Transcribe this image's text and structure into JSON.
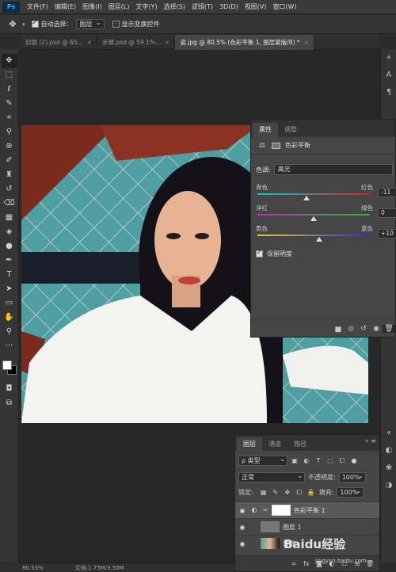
{
  "menubar": {
    "logo": "Ps",
    "items": [
      "文件(F)",
      "编辑(E)",
      "图像(I)",
      "图层(L)",
      "文字(Y)",
      "选择(S)",
      "滤镜(T)",
      "3D(D)",
      "视图(V)",
      "窗口(W)"
    ]
  },
  "options": {
    "auto_select_label": "自动选择：",
    "auto_select_value": "图层",
    "show_transform_label": "显示变换控件"
  },
  "doc_tabs": [
    {
      "label": "封面 (2).psd @ 65...",
      "active": false
    },
    {
      "label": "步骤.psd @ 59.1%...",
      "active": false
    },
    {
      "label": "姿.jpg @ 80.5% (色彩平衡 1, 图层蒙版/8) *",
      "active": true
    }
  ],
  "properties": {
    "tab_properties": "属性",
    "tab_adjustments": "调整",
    "adjustment_title": "色彩平衡",
    "tone_label": "色调:",
    "tone_value": "高光",
    "sliders": [
      {
        "left": "青色",
        "right": "红色",
        "value": -11,
        "colors": [
          "#00c8d0",
          "#e02020"
        ]
      },
      {
        "left": "洋红",
        "right": "绿色",
        "value": 0,
        "colors": [
          "#d020c0",
          "#20c030"
        ]
      },
      {
        "left": "黄色",
        "right": "蓝色",
        "value": 10,
        "colors": [
          "#e0d020",
          "#2030e0"
        ]
      }
    ],
    "slider_values_text": [
      "-11",
      "0",
      "+10"
    ],
    "preserve_luminosity_label": "保留明度",
    "preserve_luminosity": true
  },
  "layers": {
    "tab_layers": "图层",
    "tab_channels": "通道",
    "tab_paths": "路径",
    "filter_label": "ρ 类型",
    "blend_mode": "正常",
    "opacity_label": "不透明度:",
    "opacity_value": "100%",
    "lock_label": "锁定:",
    "fill_label": "填充:",
    "fill_value": "100%",
    "items": [
      {
        "name": "色彩平衡 1",
        "type": "adjustment",
        "selected": true
      },
      {
        "name": "图层 1",
        "type": "gray",
        "selected": false
      },
      {
        "name": "背景",
        "type": "photo",
        "selected": false
      }
    ]
  },
  "status": {
    "zoom": "80.53%",
    "doc": "文档:1.75M/3.50M"
  },
  "watermark": {
    "main": "Baidu经验",
    "sub": "jingyan.baidu.com"
  }
}
